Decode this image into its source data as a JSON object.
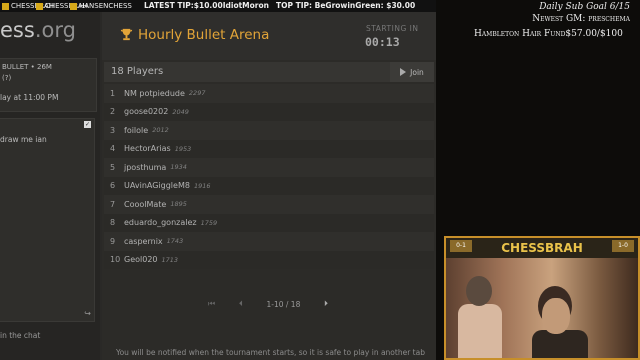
{
  "stream": {
    "brands": [
      "CHESSBRAH",
      "CHESSBRAH",
      "HANSENCHESS"
    ],
    "latest_tip": "LATEST TIP:$10.00IdiotMoron",
    "top_tip": "TOP TIP: BeGrowinGreen: $30.00",
    "sub_goal": "Daily Sub Goal 6/15",
    "newest_gm": "Newest GM: preschema",
    "hair_fund": "Hambleton Hair Fund$57.00/$100",
    "cam_title": "CHESSBRAH",
    "cam_badge_left": "0-1",
    "cam_badge_right": "1-0"
  },
  "left": {
    "logo_main": "ess",
    "logo_ext": ".org",
    "line1": "BULLET • 26M",
    "line2": "(?)",
    "line3": "lay at 11:00 PM",
    "chat_msg": "draw me ian",
    "chat_footer": "in the chat"
  },
  "tournament": {
    "title": "Hourly Bullet Arena",
    "starting_label": "STARTING IN",
    "timer": "00:13",
    "players_count": "18 Players",
    "join_label": "Join",
    "pager": "1-10 / 18",
    "notice": "You will be notified when the tournament starts, so it is safe to play in another tab",
    "players": [
      {
        "rank": "1",
        "name": "NM potpiedude",
        "rating": "2297"
      },
      {
        "rank": "2",
        "name": "goose0202",
        "rating": "2049"
      },
      {
        "rank": "3",
        "name": "foilole",
        "rating": "2012"
      },
      {
        "rank": "4",
        "name": "HectorArias",
        "rating": "1953"
      },
      {
        "rank": "5",
        "name": "jposthuma",
        "rating": "1934"
      },
      {
        "rank": "6",
        "name": "UAvinAGiggleM8",
        "rating": "1916"
      },
      {
        "rank": "7",
        "name": "CooolMate",
        "rating": "1895"
      },
      {
        "rank": "8",
        "name": "eduardo_gonzalez",
        "rating": "1759"
      },
      {
        "rank": "9",
        "name": "caspernix",
        "rating": "1743"
      },
      {
        "rank": "10",
        "name": "Geol020",
        "rating": "1713"
      }
    ]
  },
  "colors": {
    "accent": "#e2a438",
    "background": "#2a2927",
    "overlay_gold": "#e9c24a"
  },
  "icons": [
    "trophy-icon",
    "play-icon",
    "first-page-icon",
    "prev-page-icon",
    "next-page-icon",
    "reply-icon",
    "checkbox-icon"
  ]
}
